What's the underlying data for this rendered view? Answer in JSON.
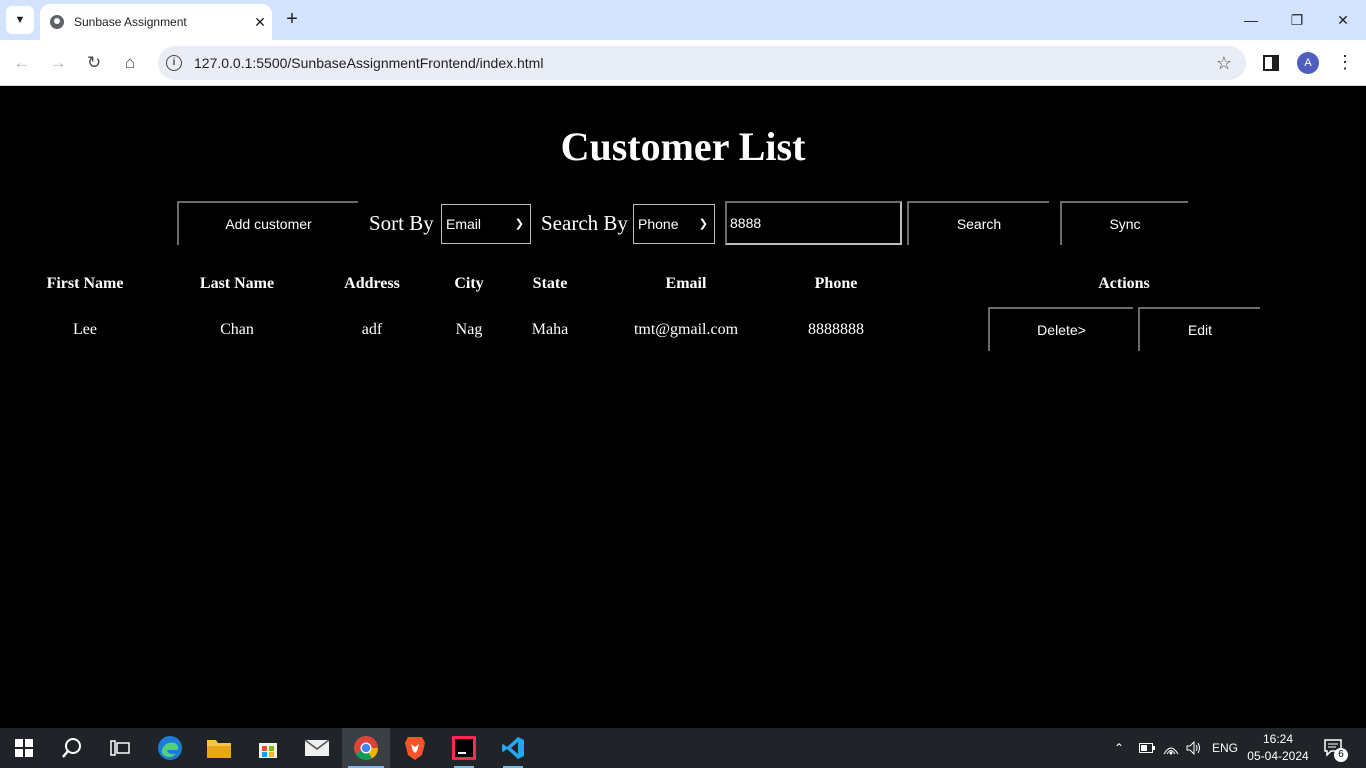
{
  "browser": {
    "tab_title": "Sunbase Assignment",
    "url": "127.0.0.1:5500/SunbaseAssignmentFrontend/index.html",
    "profile_initial": "A"
  },
  "page": {
    "title": "Customer List",
    "controls": {
      "add_customer_label": "Add customer",
      "sort_by_label": "Sort By",
      "sort_by_selected": "Email",
      "search_by_label": "Search By",
      "search_by_selected": "Phone",
      "search_value": "8888",
      "search_button_label": "Search",
      "sync_button_label": "Sync"
    },
    "table": {
      "headers": [
        "First Name",
        "Last Name",
        "Address",
        "City",
        "State",
        "Email",
        "Phone",
        "Actions"
      ],
      "rows": [
        {
          "first_name": "Lee",
          "last_name": "Chan",
          "address": "adf",
          "city": "Nag",
          "state": "Maha",
          "email": "tmt@gmail.com",
          "phone": "8888888",
          "delete_label": "Delete>",
          "edit_label": "Edit"
        }
      ]
    }
  },
  "taskbar": {
    "language": "ENG",
    "time": "16:24",
    "date": "05-04-2024",
    "notification_count": "6"
  },
  "colors": {
    "page_background": "#000000",
    "tabbar_background": "#d3e3fd",
    "taskbar_background": "#202428",
    "accent": "#7fb8e8"
  }
}
